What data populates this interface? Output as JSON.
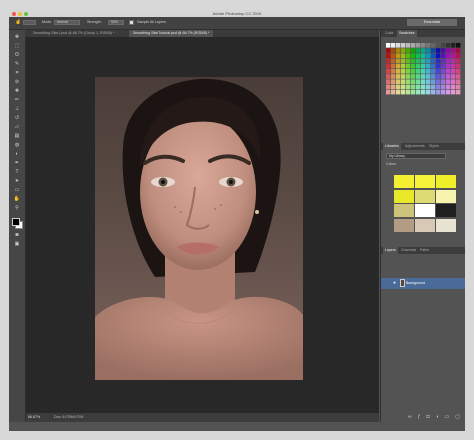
{
  "window": {
    "title": "Adobe Photoshop CC 2015"
  },
  "options_bar": {
    "mode_label": "Mode:",
    "mode_value": "Normal",
    "strength_label": "Strength:",
    "strength_value": "50%",
    "sample_label": "Sample All Layers",
    "workspace": "Essentials"
  },
  "document_tabs": [
    {
      "label": "Smoothing Skin1.psd @ 66.7% (Group 1, RGB/8) *"
    },
    {
      "label": "Smoothing SkinTutorial.psd @ 66.7% (RGB/8) *"
    }
  ],
  "status_bar": {
    "zoom": "66.67%",
    "doc_size": "Doc: 6.07M/6.07M"
  },
  "panels": {
    "color_tabs": [
      "Color",
      "Swatches"
    ],
    "library_tabs": [
      "Libraries",
      "Adjustments",
      "Styles"
    ],
    "library_selected": "My Library",
    "colors_heading": "Colors",
    "layers_tabs": [
      "Layers",
      "Channels",
      "Paths"
    ],
    "layer_name": "Background"
  },
  "colors": {
    "app_bg": "#535353",
    "canvas_bg": "#282828",
    "layer_selected": "#4a6a98",
    "library_colors": [
      "#f3f032",
      "#f6f43a",
      "#f0ee2a",
      "#e9e72a",
      "#dcdc72",
      "#f7f4b0",
      "#cdc37a",
      "#ffffff",
      "#1f1f1f",
      "#b39c84",
      "#d7c9b5",
      "#e8e2d2"
    ]
  }
}
